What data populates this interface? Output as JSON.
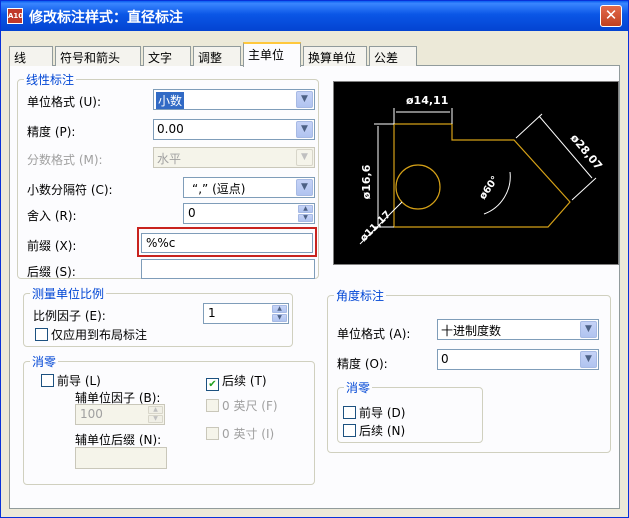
{
  "window": {
    "title": "修改标注样式：直径标注",
    "icon_text": "A10",
    "close_glyph": "✕"
  },
  "tabs": [
    "线",
    "符号和箭头",
    "文字",
    "调整",
    "主单位",
    "换算单位",
    "公差"
  ],
  "active_tab": "主单位",
  "linear": {
    "legend": "线性标注",
    "unit_format_label": "单位格式 (U):",
    "unit_format_value": "小数",
    "precision_label": "精度 (P):",
    "precision_value": "0.00",
    "fraction_format_label": "分数格式 (M):",
    "fraction_format_value": "水平",
    "decimal_sep_label": "小数分隔符 (C):",
    "decimal_sep_value": "“,”  (逗点)",
    "round_label": "舍入 (R):",
    "round_value": "0",
    "prefix_label": "前缀 (X):",
    "prefix_value": "%%c",
    "suffix_label": "后缀 (S):",
    "suffix_value": ""
  },
  "measurement_scale": {
    "legend": "测量单位比例",
    "scale_label": "比例因子 (E):",
    "scale_value": "1",
    "layout_only_label": "仅应用到布局标注"
  },
  "zero_suppression": {
    "legend": "消零",
    "leading_label": "前导 (L)",
    "trailing_label": "后续 (T)",
    "sub_factor_label": "辅单位因子 (B):",
    "sub_factor_value": "100",
    "sub_suffix_label": "辅单位后缀 (N):",
    "feet_label": "0 英尺 (F)",
    "inches_label": "0 英寸 (I)",
    "check_glyph": "✔"
  },
  "angular": {
    "legend": "角度标注",
    "unit_format_label": "单位格式 (A):",
    "unit_format_value": "十进制度数",
    "precision_label": "精度 (O):",
    "precision_value": "0",
    "zero_legend": "消零",
    "leading_label": "前导 (D)",
    "trailing_label": "后续 (N)"
  },
  "preview": {
    "dim_top": "ø14,11",
    "dim_left": "ø16,6",
    "dim_right": "ø28,07",
    "dim_angle": "ø60°",
    "dim_diameter": "ø11,17"
  },
  "glyphs": {
    "dropdown": "▼",
    "spin_up": "▲",
    "spin_down": "▼"
  },
  "colors": {
    "title_blue": "#0A56E6",
    "legend_blue": "#0046D5",
    "highlight_red": "#C8231E",
    "preview_geometry": "#D4A017",
    "preview_dims": "#FFFFFF"
  }
}
